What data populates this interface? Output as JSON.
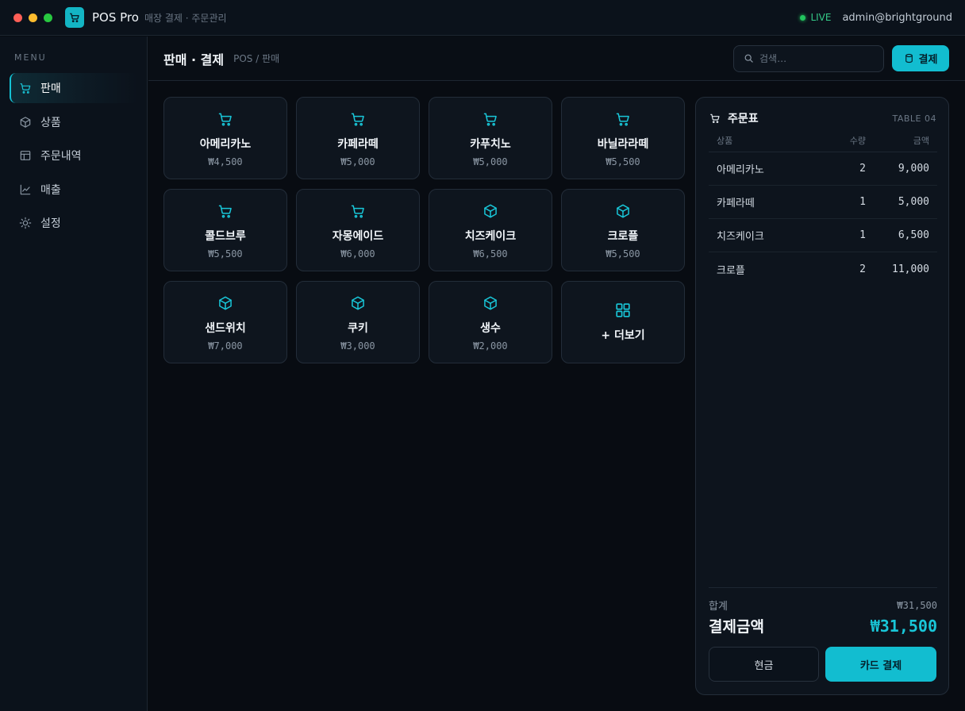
{
  "window": {
    "app_name": "POS Pro",
    "subtitle": "매장 결제 · 주문관리",
    "status": "LIVE",
    "user": "admin@brightground",
    "traffic_lights": [
      "#ff5f57",
      "#febc2e",
      "#28c840"
    ],
    "app_icon": "cart-icon"
  },
  "sidebar": {
    "menu_label": "MENU",
    "items": [
      {
        "label": "판매",
        "icon": "cart-icon",
        "active": true
      },
      {
        "label": "상품",
        "icon": "box-icon",
        "active": false
      },
      {
        "label": "주문내역",
        "icon": "table-icon",
        "active": false
      },
      {
        "label": "매출",
        "icon": "chart-line-icon",
        "active": false
      },
      {
        "label": "설정",
        "icon": "sun-gear-icon",
        "active": false
      }
    ]
  },
  "header": {
    "title": "판매 · 결제",
    "breadcrumb": "POS / 판매",
    "search_placeholder": "검색…",
    "pay_button": "결제",
    "pay_icon": "cylinder-icon"
  },
  "products": [
    {
      "name": "아메리카노",
      "price": "₩4,500",
      "icon": "cart-icon"
    },
    {
      "name": "카페라떼",
      "price": "₩5,000",
      "icon": "cart-icon"
    },
    {
      "name": "카푸치노",
      "price": "₩5,000",
      "icon": "cart-icon"
    },
    {
      "name": "바닐라라떼",
      "price": "₩5,500",
      "icon": "cart-icon"
    },
    {
      "name": "콜드브루",
      "price": "₩5,500",
      "icon": "cart-icon"
    },
    {
      "name": "자몽에이드",
      "price": "₩6,000",
      "icon": "cart-icon"
    },
    {
      "name": "치즈케이크",
      "price": "₩6,500",
      "icon": "box-icon"
    },
    {
      "name": "크로플",
      "price": "₩5,500",
      "icon": "box-icon"
    },
    {
      "name": "샌드위치",
      "price": "₩7,000",
      "icon": "box-icon"
    },
    {
      "name": "쿠키",
      "price": "₩3,000",
      "icon": "box-icon"
    },
    {
      "name": "생수",
      "price": "₩2,000",
      "icon": "box-icon"
    }
  ],
  "more_button": {
    "label": "+ 더보기",
    "icon": "grid-icon"
  },
  "order": {
    "title": "주문표",
    "table_no": "TABLE 04",
    "columns": [
      "상품",
      "수량",
      "금액"
    ],
    "rows": [
      {
        "name": "아메리카노",
        "qty": "2",
        "amount": "9,000"
      },
      {
        "name": "카페라떼",
        "qty": "1",
        "amount": "5,000"
      },
      {
        "name": "치즈케이크",
        "qty": "1",
        "amount": "6,500"
      },
      {
        "name": "크로플",
        "qty": "2",
        "amount": "11,000"
      }
    ],
    "subtotal_label": "합계",
    "subtotal": "₩31,500",
    "total_label": "결제금액",
    "total": "₩31,500",
    "cash_button": "현금",
    "card_button": "카드 결제"
  },
  "colors": {
    "accent": "#12bdd0",
    "live": "#22c55e",
    "background": "#080c12"
  }
}
